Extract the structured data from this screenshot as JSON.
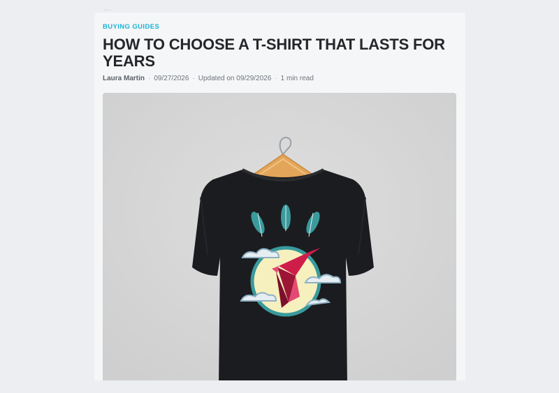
{
  "top_snippet": "…",
  "article": {
    "category": "BUYING GUIDES",
    "title": "HOW TO CHOOSE A T-SHIRT THAT LASTS FOR YEARS",
    "author": "Laura Martin",
    "published": "09/27/2026",
    "updated": "Updated on 09/29/2026",
    "read_time": "1 min read",
    "separator": "·",
    "hero_image": {
      "subject": "black-tshirt-on-hanger-hummingbird-print",
      "colors": {
        "background": "#d6d6d6",
        "shirt": "#1b1c1f",
        "hanger": "#e2a55a",
        "moon": "#f6f0bf",
        "bird": "#cf1d4a",
        "feathers": "#3a9a9c"
      }
    }
  },
  "colors": {
    "accent": "#1bb2d6",
    "text": "#25262a",
    "page": "#eceef1",
    "card": "#f5f6f7"
  }
}
